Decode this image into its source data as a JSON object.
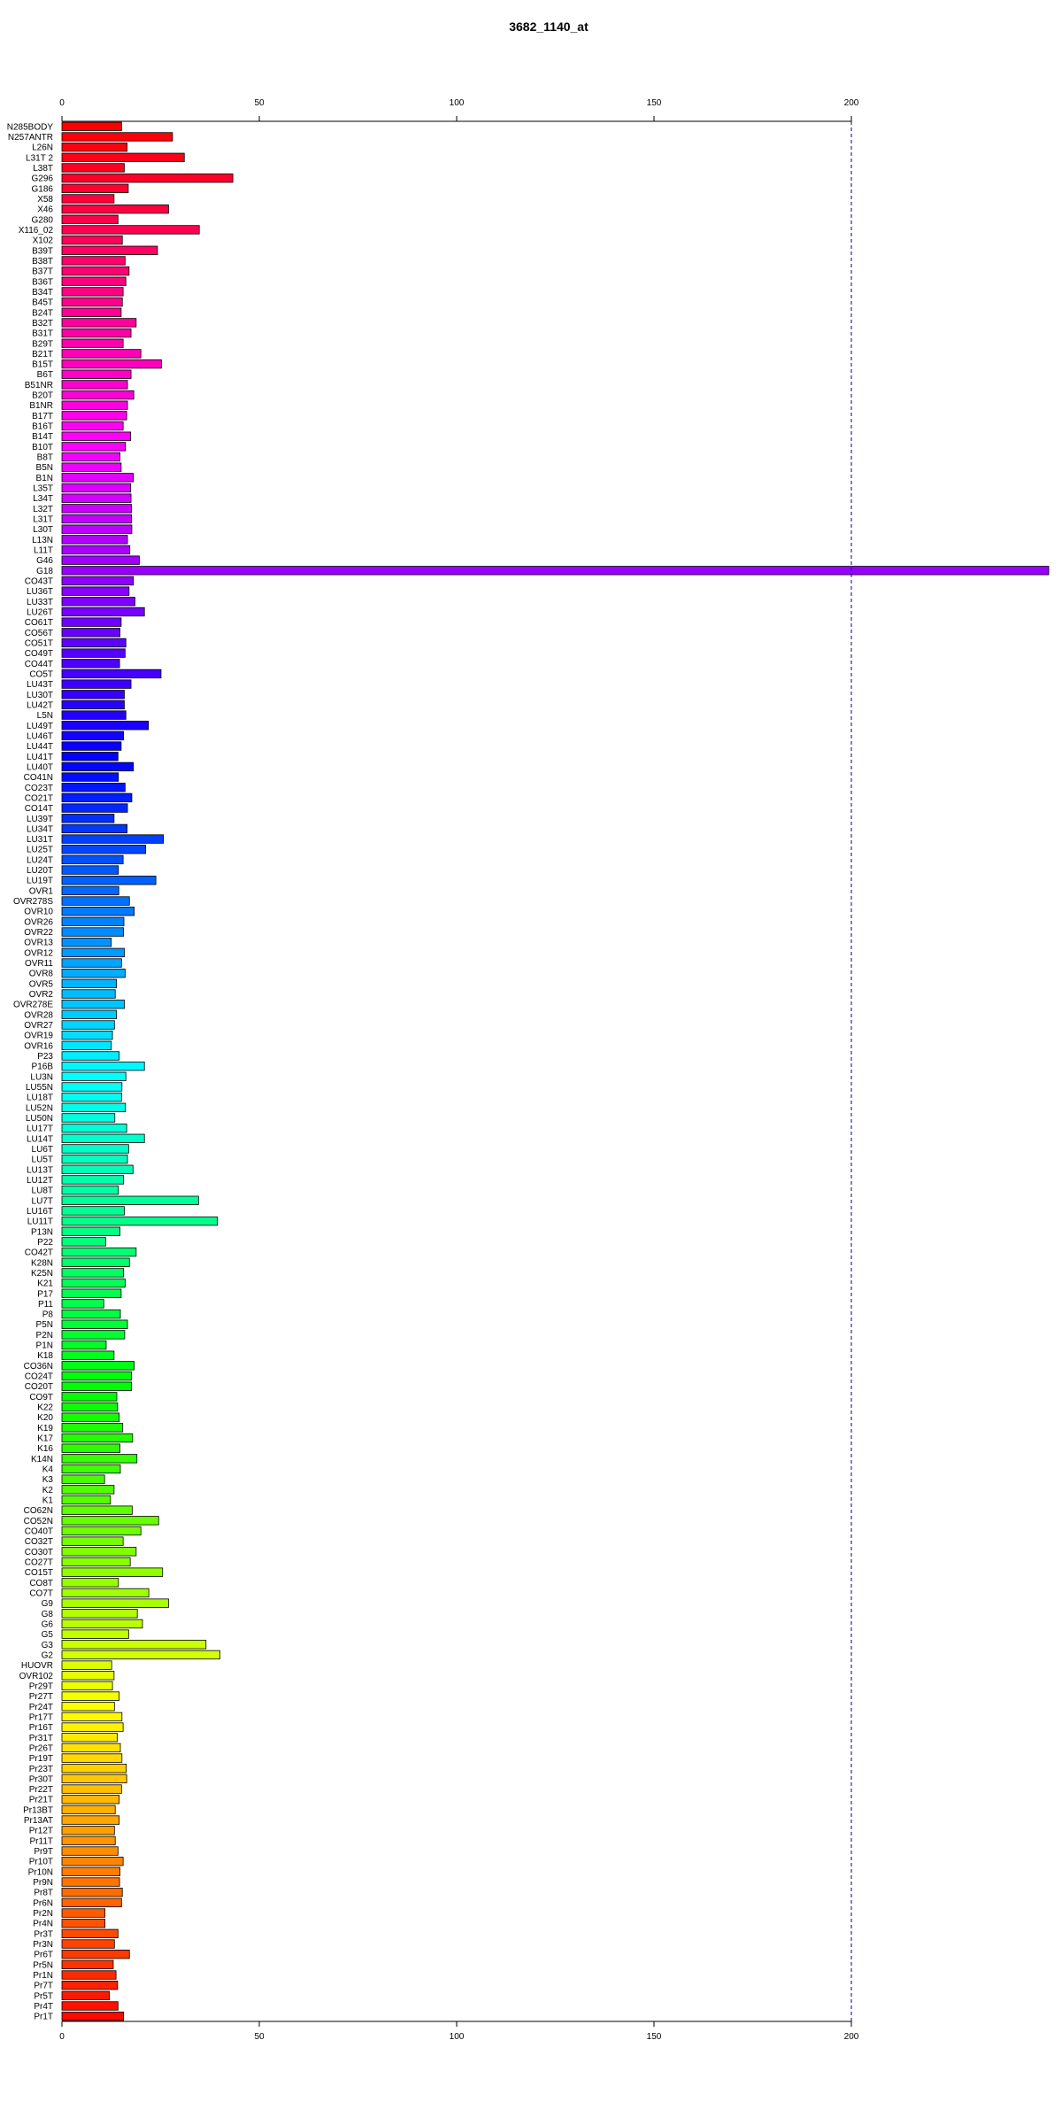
{
  "chart_data": {
    "type": "bar",
    "orientation": "horizontal",
    "title": "3682_1140_at",
    "xlabel": "",
    "ylabel": "",
    "xlim": [
      0,
      200
    ],
    "xticks": [
      0,
      50,
      100,
      150,
      200
    ],
    "reference_line": {
      "value": 200,
      "style": "dashed",
      "color": "#00008b"
    },
    "grid": false,
    "categories": [
      "N285BODY",
      "N257ANTR",
      "L26N",
      "L31T 2",
      "L38T",
      "G296",
      "G186",
      "X58",
      "X46",
      "G280",
      "X116_02",
      "X102",
      "B39T",
      "B38T",
      "B37T",
      "B36T",
      "B34T",
      "B45T",
      "B24T",
      "B32T",
      "B31T",
      "B29T",
      "B21T",
      "B15T",
      "B6T",
      "B51NR",
      "B20T",
      "B1NR",
      "B17T",
      "B16T",
      "B14T",
      "B10T",
      "B8T",
      "B5N",
      "B1N",
      "L35T",
      "L34T",
      "L32T",
      "L31T",
      "L30T",
      "L13N",
      "L11T",
      "G46",
      "G18",
      "CO43T",
      "LU36T",
      "LU33T",
      "LU26T",
      "CO61T",
      "CO56T",
      "CO51T",
      "CO49T",
      "CO44T",
      "CO5T",
      "LU43T",
      "LU30T",
      "LU42T",
      "L5N",
      "LU49T",
      "LU46T",
      "LU44T",
      "LU41T",
      "LU40T",
      "CO41N",
      "CO23T",
      "CO21T",
      "CO14T",
      "LU39T",
      "LU34T",
      "LU31T",
      "LU25T",
      "LU24T",
      "LU20T",
      "LU19T",
      "OVR1",
      "OVR278S",
      "OVR10",
      "OVR26",
      "OVR22",
      "OVR13",
      "OVR12",
      "OVR11",
      "OVR8",
      "OVR5",
      "OVR2",
      "OVR278E",
      "OVR28",
      "OVR27",
      "OVR19",
      "OVR16",
      "P23",
      "P16B",
      "LU3N",
      "LU55N",
      "LU18T",
      "LU52N",
      "LU50N",
      "LU17T",
      "LU14T",
      "LU6T",
      "LU5T",
      "LU13T",
      "LU12T",
      "LU8T",
      "LU7T",
      "LU16T",
      "LU11T",
      "P13N",
      "P22",
      "CO42T",
      "K28N",
      "K25N",
      "K21",
      "P17",
      "P11",
      "P8",
      "P5N",
      "P2N",
      "P1N",
      "K18",
      "CO36N",
      "CO24T",
      "CO20T",
      "CO9T",
      "K22",
      "K20",
      "K19",
      "K17",
      "K16",
      "K14N",
      "K4",
      "K3",
      "K2",
      "K1",
      "CO62N",
      "CO52N",
      "CO40T",
      "CO32T",
      "CO30T",
      "CO27T",
      "CO15T",
      "CO8T",
      "CO7T",
      "G9",
      "G8",
      "G6",
      "G5",
      "G3",
      "G2",
      "HUOVR",
      "OVR102",
      "Pr29T",
      "Pr27T",
      "Pr24T",
      "Pr17T",
      "Pr16T",
      "Pr31T",
      "Pr26T",
      "Pr19T",
      "Pr23T",
      "Pr30T",
      "Pr22T",
      "Pr21T",
      "Pr13BT",
      "Pr13AT",
      "Pr12T",
      "Pr11T",
      "Pr9T",
      "Pr10T",
      "Pr10N",
      "Pr9N",
      "Pr8T",
      "Pr6N",
      "Pr2N",
      "Pr4N",
      "Pr3T",
      "Pr3N",
      "Pr6T",
      "Pr5N",
      "Pr1N",
      "Pr7T",
      "Pr5T",
      "Pr4T",
      "Pr1T"
    ],
    "values": [
      15.1,
      28,
      16.5,
      31,
      15.8,
      43.3,
      16.8,
      13.2,
      27,
      14.2,
      34.8,
      15.3,
      24.2,
      16,
      17,
      16.2,
      15.5,
      15.3,
      15,
      18.8,
      17.5,
      15.5,
      20,
      25.2,
      17.5,
      16.6,
      18.2,
      16.6,
      16.4,
      15.5,
      17.4,
      16.1,
      14.7,
      15,
      18.1,
      17.4,
      17.5,
      17.6,
      17.6,
      17.7,
      16.6,
      17.2,
      19.6,
      250,
      18.1,
      17,
      18.5,
      20.9,
      15,
      14.7,
      16.2,
      16,
      14.6,
      25.1,
      17.5,
      15.8,
      15.8,
      16.2,
      21.9,
      15.6,
      15,
      14.2,
      18.1,
      14.3,
      16,
      17.7,
      16.6,
      13.2,
      16.5,
      25.7,
      21.2,
      15.5,
      14.3,
      23.8,
      14.4,
      17.1,
      18.3,
      15.7,
      15.6,
      12.5,
      15.8,
      15.1,
      16,
      13.8,
      13.5,
      15.8,
      13.8,
      13.3,
      12.8,
      12.5,
      14.5,
      20.9,
      16.2,
      15.2,
      15.1,
      16.1,
      13.4,
      16.4,
      20.9,
      16.9,
      16.6,
      18,
      15.6,
      14.3,
      34.6,
      15.8,
      39.4,
      14.7,
      11.1,
      18.8,
      17.1,
      15.6,
      16,
      15,
      10.6,
      14.8,
      16.6,
      15.9,
      11.2,
      13.2,
      18.3,
      17.6,
      17.6,
      13.9,
      14.1,
      14.5,
      15.4,
      17.9,
      14.7,
      19,
      14.8,
      10.8,
      13.2,
      12.3,
      17.8,
      24.5,
      20,
      15.5,
      18.8,
      17.3,
      25.5,
      14.3,
      22,
      27,
      19.1,
      20.4,
      16.9,
      36.5,
      40,
      12.6,
      13.2,
      12.8,
      14.5,
      13.3,
      15.2,
      15.5,
      14,
      14.8,
      15.2,
      16.3,
      16.4,
      15.1,
      14.5,
      13.5,
      14.5,
      13.3,
      13.5,
      14.2,
      15.5,
      14.7,
      14.6,
      15.3,
      15.1,
      10.9,
      10.9,
      14.2,
      13.3,
      17.1,
      13,
      13.7,
      14.1,
      12,
      14.2,
      15.6
    ],
    "bar_color_sequence": "rainbow (red → magenta → purple → blue → cyan → green → yellow → orange → red)"
  }
}
